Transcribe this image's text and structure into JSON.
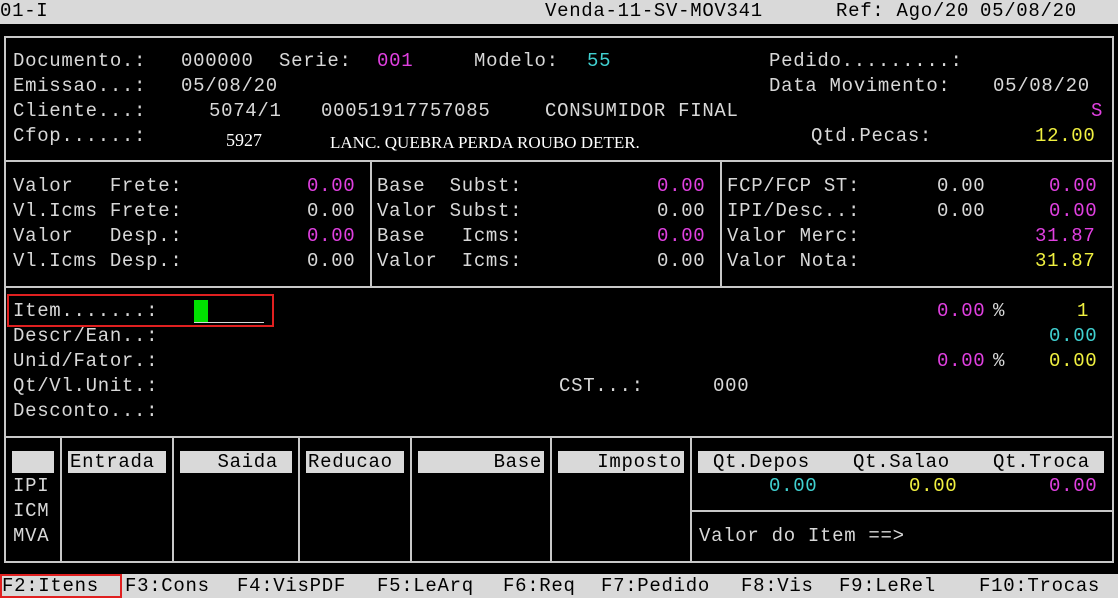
{
  "topbar": {
    "left": "01-I",
    "center": "Venda-11-SV-MOV341",
    "ref": "Ref: Ago/20",
    "date": "05/08/20"
  },
  "header": {
    "documento_label": "Documento.:",
    "documento": "000000",
    "serie_label": "Serie:",
    "serie": "001",
    "modelo_label": "Modelo:",
    "modelo": "55",
    "pedido_label": "Pedido.........:",
    "emissao_label": "Emissao...:",
    "emissao": "05/08/20",
    "data_mov_label": "Data Movimento:",
    "data_mov": "05/08/20",
    "cliente_label": "Cliente...:",
    "cliente_code": "5074/1",
    "cliente_doc": "00051917757085",
    "cliente_name": "CONSUMIDOR FINAL",
    "cliente_flag": "S",
    "cfop_label": "Cfop......:",
    "cfop": "5927",
    "cfop_desc": "LANC. QUEBRA PERDA ROUBO DETER.",
    "qtd_pecas_label": "Qtd.Pecas:",
    "qtd_pecas": "12.00"
  },
  "totals": {
    "col1": [
      {
        "label": "Valor   Frete:",
        "value": "0.00",
        "color": "mag"
      },
      {
        "label": "Vl.Icms Frete:",
        "value": "0.00",
        "color": "gray"
      },
      {
        "label": "Valor   Desp.:",
        "value": "0.00",
        "color": "mag"
      },
      {
        "label": "Vl.Icms Desp.:",
        "value": "0.00",
        "color": "gray"
      }
    ],
    "col2": [
      {
        "label": "Base  Subst:",
        "value": "0.00",
        "color": "mag"
      },
      {
        "label": "Valor Subst:",
        "value": "0.00",
        "color": "gray"
      },
      {
        "label": "Base   Icms:",
        "value": "0.00",
        "color": "mag"
      },
      {
        "label": "Valor  Icms:",
        "value": "0.00",
        "color": "gray"
      }
    ],
    "col3": [
      {
        "label": "FCP/FCP ST:",
        "mid": "0.00",
        "value": "0.00",
        "color": "mag"
      },
      {
        "label": "IPI/Desc..:",
        "mid": "0.00",
        "value": "0.00",
        "color": "mag"
      },
      {
        "label": "Valor Merc:",
        "mid": "",
        "value": "31.87",
        "color": "mag"
      },
      {
        "label": "Valor Nota:",
        "mid": "",
        "value": "31.87",
        "color": "yel"
      }
    ]
  },
  "item": {
    "item_label": "Item.......:",
    "descr_label": "Descr/Ean..:",
    "unid_label": "Unid/Fator.:",
    "qt_label": "Qt/Vl.Unit.:",
    "desconto_label": "Desconto...:",
    "cst_label": "CST...:",
    "cst_value": "000",
    "pct1": "0.00",
    "pct_sign1": "%",
    "count": "1",
    "descr_value": "0.00",
    "pct2": "0.00",
    "pct_sign2": "%",
    "unid_value": "0.00"
  },
  "taxes": {
    "headers": [
      "Entrada",
      "Saida",
      "Reducao",
      "Base",
      "Imposto"
    ],
    "rows": [
      "IPI",
      "ICM",
      "MVA"
    ]
  },
  "stock": {
    "headers": [
      "Qt.Depos",
      "Qt.Salao",
      "Qt.Troca"
    ],
    "values": [
      "0.00",
      "0.00",
      "0.00"
    ],
    "valor_item_label": "Valor do Item ==>"
  },
  "fkeys": [
    "F2:Itens",
    "F3:Cons",
    "F4:VisPDF",
    "F5:LeArq",
    "F6:Req",
    "F7:Pedido",
    "F8:Vis",
    "F9:LeRel",
    "F10:Trocas"
  ],
  "colors": {
    "magenta": "#e040e0",
    "cyan": "#40d0d0",
    "yellow": "#f0f040",
    "cursor": "#00e000",
    "highlight": "#e02020"
  }
}
